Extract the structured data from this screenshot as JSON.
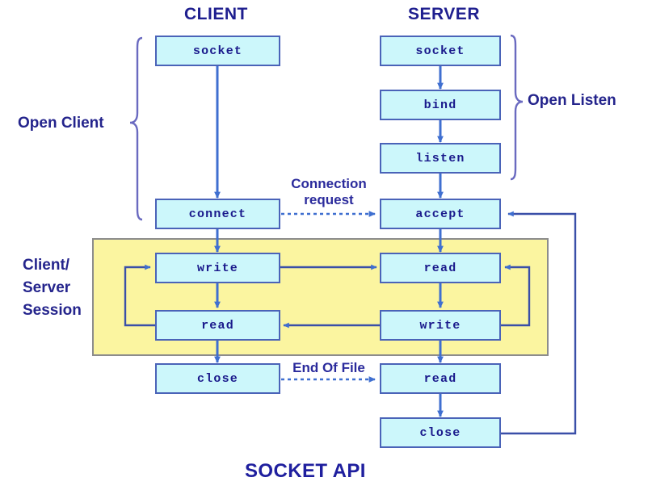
{
  "title": "SOCKET API",
  "columns": {
    "client": "CLIENT",
    "server": "SERVER"
  },
  "brackets": {
    "open_client": "Open Client",
    "open_listen": "Open Listen",
    "session_line1": "Client/",
    "session_line2": "Server",
    "session_line3": "Session"
  },
  "edge_labels": {
    "connection_request_line1": "Connection",
    "connection_request_line2": "request",
    "end_of_file": "End Of File"
  },
  "client_nodes": [
    {
      "id": "client-socket",
      "label": "socket"
    },
    {
      "id": "client-connect",
      "label": "connect"
    },
    {
      "id": "client-write",
      "label": "write"
    },
    {
      "id": "client-read",
      "label": "read"
    },
    {
      "id": "client-close",
      "label": "close"
    }
  ],
  "server_nodes": [
    {
      "id": "server-socket",
      "label": "socket"
    },
    {
      "id": "server-bind",
      "label": "bind"
    },
    {
      "id": "server-listen",
      "label": "listen"
    },
    {
      "id": "server-accept",
      "label": "accept"
    },
    {
      "id": "server-read-1",
      "label": "read"
    },
    {
      "id": "server-write",
      "label": "write"
    },
    {
      "id": "server-read-2",
      "label": "read"
    },
    {
      "id": "server-close",
      "label": "close"
    }
  ],
  "colors": {
    "node_fill": "#ccf7fb",
    "node_border": "#4a63b8",
    "session_fill": "#fbf5a0",
    "session_border": "#8c8c8c",
    "arrow": "#3f6fd0",
    "text": "#1a1a8c",
    "title": "#1f1f9e"
  }
}
